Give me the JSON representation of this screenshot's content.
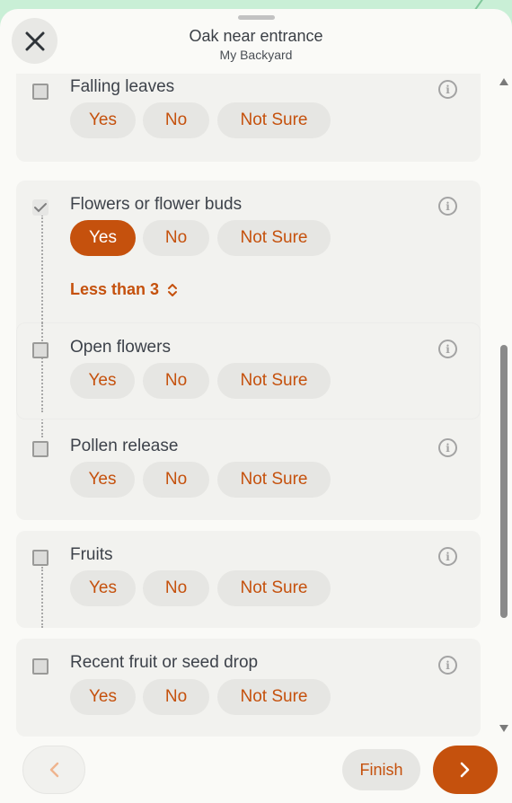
{
  "header": {
    "title": "Oak near entrance",
    "subtitle": "My Backyard"
  },
  "options": {
    "yes": "Yes",
    "no": "No",
    "not_sure": "Not Sure"
  },
  "questions": {
    "falling_leaves": {
      "label": "Falling leaves",
      "selected": null
    },
    "flowers": {
      "label": "Flowers or flower buds",
      "selected": "Yes",
      "checked": true,
      "amount": "Less than 3"
    },
    "open_flowers": {
      "label": "Open flowers",
      "selected": null
    },
    "pollen_release": {
      "label": "Pollen release",
      "selected": null
    },
    "fruits": {
      "label": "Fruits",
      "selected": null
    },
    "fruit_drop": {
      "label": "Recent fruit or seed drop",
      "selected": null
    }
  },
  "footer": {
    "finish_label": "Finish"
  },
  "colors": {
    "accent": "#c5510d",
    "pill": "#e6e6e3",
    "card": "#f2f2ef",
    "sheet": "#fafaf7",
    "background": "#c9efd6"
  },
  "icons": [
    "close-icon",
    "info-icon",
    "check-icon",
    "chevron-up-down-icon",
    "chevron-left-icon",
    "chevron-right-icon"
  ]
}
